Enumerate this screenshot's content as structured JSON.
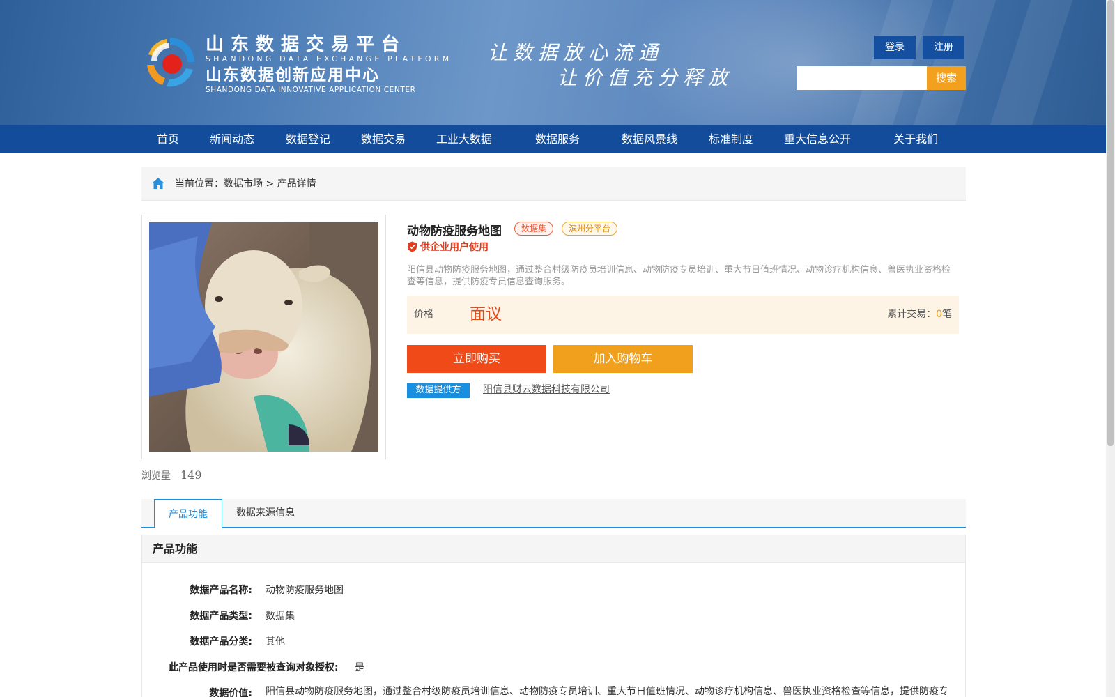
{
  "header": {
    "logo_cn1": "山东数据交易平台",
    "logo_en1": "SHANDONG DATA EXCHANGE PLATFORM",
    "logo_cn2": "山东数据创新应用中心",
    "logo_en2": "SHANDONG DATA INNOVATIVE APPLICATION CENTER",
    "slogan_line1": "让数据放心流通",
    "slogan_line2": "让价值充分释放",
    "login_label": "登录",
    "register_label": "注册",
    "search_value": "",
    "search_button": "搜索"
  },
  "nav": {
    "items": [
      "首页",
      "新闻动态",
      "数据登记",
      "数据交易",
      "工业大数据",
      "数据服务",
      "数据风景线",
      "标准制度",
      "重大信息公开",
      "关于我们"
    ]
  },
  "breadcrumb": {
    "prefix": "当前位置：",
    "level1": "数据市场",
    "separator": " > ",
    "level2": "产品详情"
  },
  "product": {
    "title": "动物防疫服务地图",
    "tag_type": "数据集",
    "tag_platform": "滨州分平台",
    "enterprise_note": "供企业用户使用",
    "description": "阳信县动物防疫服务地图，通过整合村级防疫员培训信息、动物防疫专员培训、重大节日值班情况、动物诊疗机构信息、兽医执业资格检查等信息，提供防疫专员信息查询服务。",
    "price_label": "价格",
    "price_value": "面议",
    "trade_label": "累计交易：",
    "trade_count": "0",
    "trade_unit": "笔",
    "buy_button": "立即购买",
    "cart_button": "加入购物车",
    "provider_badge": "数据提供方",
    "provider_name": "阳信县财云数据科技有限公司",
    "views_label": "浏览量",
    "views_count": "149"
  },
  "tabs": {
    "items": [
      "产品功能",
      "数据来源信息"
    ],
    "active": "产品功能"
  },
  "function_section": {
    "heading": "产品功能",
    "rows": [
      {
        "key": "数据产品名称:",
        "value": "动物防疫服务地图"
      },
      {
        "key": "数据产品类型:",
        "value": "数据集"
      },
      {
        "key": "数据产品分类:",
        "value": "其他"
      },
      {
        "key": "此产品使用时是否需要被查询对象授权:",
        "value": "是"
      },
      {
        "key": "数据价值:",
        "value": "阳信县动物防疫服务地图，通过整合村级防疫员培训信息、动物防疫专员培训、重大节日值班情况、动物诊疗机构信息、兽医执业资格检查等信息，提供防疫专员信息查询服务。"
      }
    ]
  },
  "colors": {
    "nav_bg": "#124c9a",
    "accent_blue": "#1a8fe0",
    "buy_red": "#ef4a17",
    "cart_orange": "#f0a01c",
    "search_orange": "#f4a01f"
  }
}
